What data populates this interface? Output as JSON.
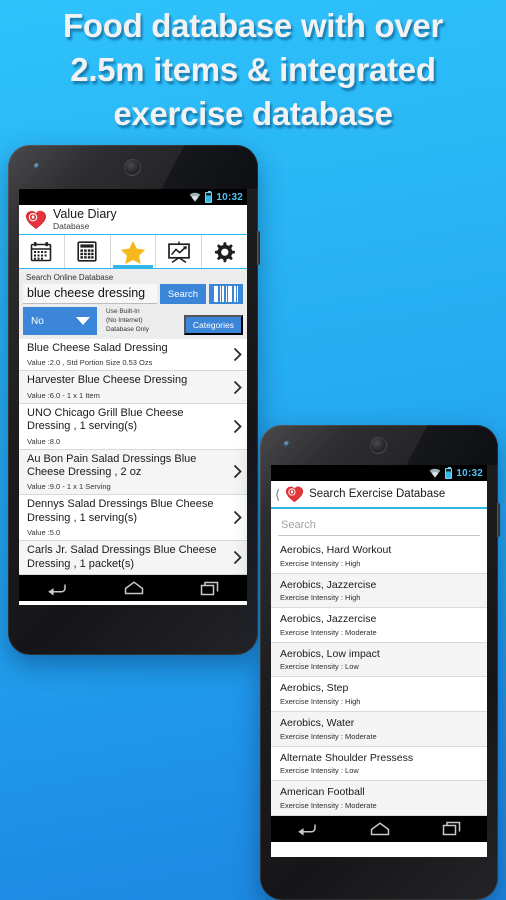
{
  "headline": {
    "lines": [
      "Food database with over",
      "2.5m items & integrated",
      "exercise database"
    ]
  },
  "colors": {
    "bg_top": "#2ec2fb",
    "bg_bottom": "#1d86e0",
    "accent_blue": "#3b86d8",
    "tab_active": "#33b5e5",
    "status_time": "#4fc3f7",
    "logo_red": "#d9252a"
  },
  "phone_front": {
    "statusbar": {
      "wifi_icon": "wifi-icon",
      "battery_icon": "battery-icon",
      "time": "10:32"
    },
    "app_header": {
      "logo_icon": "heart-logo-icon",
      "title": "Value Diary",
      "subtitle": "Database"
    },
    "tabs": [
      {
        "icon": "calendar-icon",
        "name": "tab-calendar",
        "active": false
      },
      {
        "icon": "calculator-icon",
        "name": "tab-calculator",
        "active": false
      },
      {
        "icon": "star-icon",
        "name": "tab-favorites",
        "active": true
      },
      {
        "icon": "chart-board-icon",
        "name": "tab-reports",
        "active": false
      },
      {
        "icon": "gear-icon",
        "name": "tab-settings",
        "active": false
      }
    ],
    "search": {
      "label": "Search Online Database",
      "value": "blue cheese dressing",
      "placeholder": "Search Online Database",
      "search_button": "Search",
      "barcode_icon": "barcode-scanner-icon",
      "spinner_value": "No",
      "spinner_caret": "chevron-down-icon",
      "builtin_note_lines": [
        "Use Built-In",
        "(No Internet)",
        "Database Only"
      ],
      "categories_button": "Categories"
    },
    "results": [
      {
        "title": "Blue Cheese Salad Dressing",
        "value": "Value :2.0 , Std Portion Size 0.53 Ozs"
      },
      {
        "title": "Harvester Blue Cheese Dressing",
        "value": "Value :6.0 - 1 x 1   Item"
      },
      {
        "title": "UNO Chicago Grill Blue Cheese Dressing , 1 serving(s)",
        "value": "Value :8.0"
      },
      {
        "title": "Au Bon Pain Salad Dressings Blue Cheese Dressing , 2 oz",
        "value": "Value :9.0 - 1 x 1   Serving"
      },
      {
        "title": "Dennys Salad Dressings Blue Cheese Dressing , 1 serving(s)",
        "value": "Value :5.0"
      },
      {
        "title": "Carls Jr. Salad Dressings Blue Cheese Dressing , 1 packet(s)",
        "value": ""
      }
    ],
    "navbar": [
      {
        "icon": "back-icon",
        "name": "nav-back"
      },
      {
        "icon": "home-icon",
        "name": "nav-home"
      },
      {
        "icon": "recents-icon",
        "name": "nav-recents"
      }
    ]
  },
  "phone_back": {
    "statusbar": {
      "wifi_icon": "wifi-icon",
      "battery_icon": "battery-icon",
      "time": "10:32"
    },
    "app_header": {
      "back_icon": "back-chevron-icon",
      "logo_icon": "heart-logo-icon",
      "title": "Search Exercise Database"
    },
    "search": {
      "value": "",
      "placeholder": "Search"
    },
    "exercises": [
      {
        "name": "Aerobics, Hard Workout",
        "intensity": "Exercise Intensity : High"
      },
      {
        "name": "Aerobics, Jazzercise",
        "intensity": "Exercise Intensity : High"
      },
      {
        "name": "Aerobics, Jazzercise",
        "intensity": "Exercise Intensity : Moderate"
      },
      {
        "name": "Aerobics, Low impact",
        "intensity": "Exercise Intensity : Low"
      },
      {
        "name": "Aerobics, Step",
        "intensity": "Exercise Intensity : High"
      },
      {
        "name": "Aerobics, Water",
        "intensity": "Exercise Intensity : Moderate"
      },
      {
        "name": "Alternate Shoulder Pressess",
        "intensity": "Exercise Intensity : Low"
      },
      {
        "name": "American Football",
        "intensity": "Exercise Intensity : Moderate"
      }
    ],
    "navbar": [
      {
        "icon": "back-icon",
        "name": "nav-back"
      },
      {
        "icon": "home-icon",
        "name": "nav-home"
      },
      {
        "icon": "recents-icon",
        "name": "nav-recents"
      }
    ]
  }
}
